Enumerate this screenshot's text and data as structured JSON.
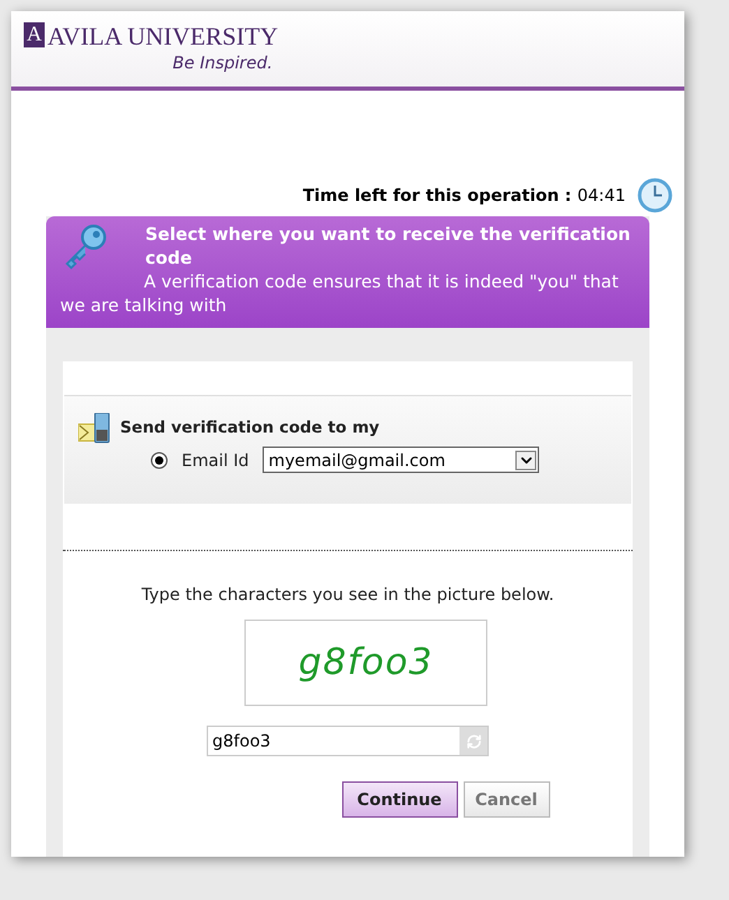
{
  "header": {
    "logo_letter": "A",
    "university": "AVILA UNIVERSITY",
    "tagline": "Be Inspired."
  },
  "timer": {
    "label": "Time left for this operation :",
    "value": "04:41"
  },
  "banner": {
    "title": "Select where you want to receive the verification code",
    "subtitle": "A verification code ensures that it is indeed \"you\" that we are talking with"
  },
  "send": {
    "heading": "Send verification code to my",
    "options": [
      {
        "label": "Email Id",
        "selected": true,
        "value": "myemail@gmail.com"
      }
    ]
  },
  "captcha": {
    "instruction": "Type the characters you see in the picture below.",
    "image_text": "g8foo3",
    "value": "g8foo3"
  },
  "buttons": [
    {
      "label": "Continue",
      "kind": "primary"
    },
    {
      "label": "Cancel",
      "kind": "secondary"
    }
  ]
}
